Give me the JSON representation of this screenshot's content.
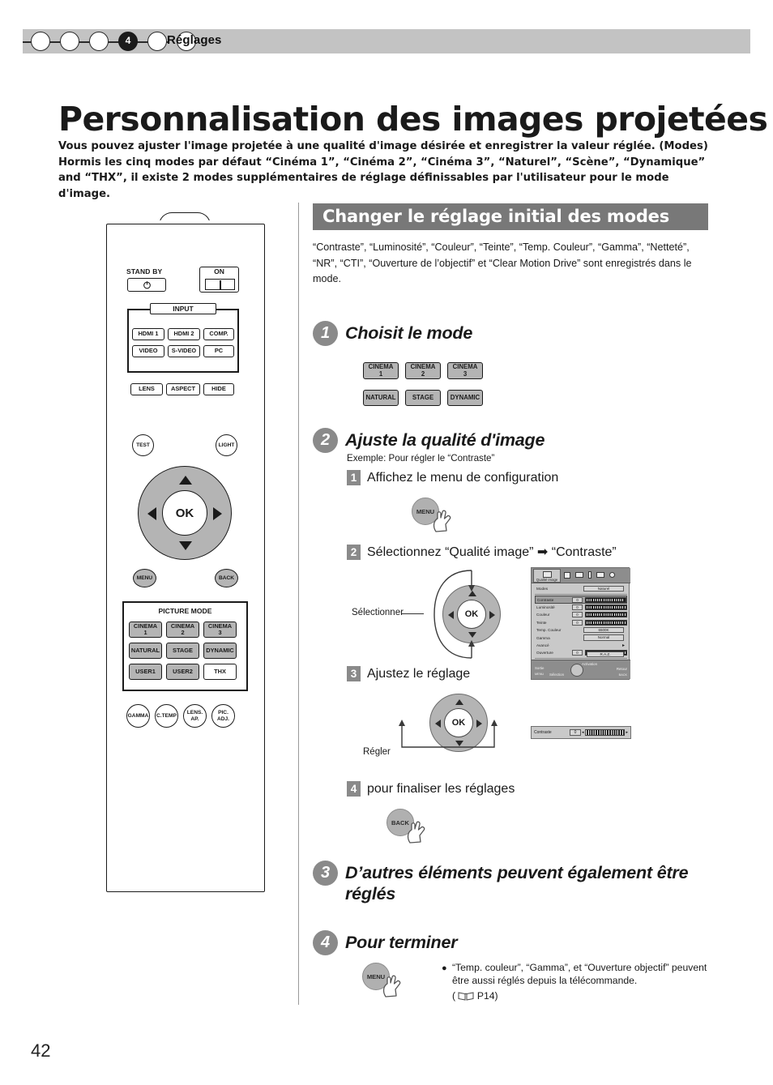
{
  "chapter": {
    "number": "4",
    "title": "Réglages",
    "dots_total": 6,
    "active_index": 3
  },
  "page": {
    "title": "Personnalisation des images projetées",
    "number": "42",
    "intro": "Vous pouvez ajuster l'image projetée à une qualité d'image désirée et enregistrer la valeur réglée. (Modes) Hormis les cinq modes par défaut “Cinéma 1”, “Cinéma 2”, “Cinéma 3”, “Naturel”, “Scène”, “Dynamique” and “THX”, il existe 2 modes supplémentaires de réglage définissables par l'utilisateur pour le mode d'image."
  },
  "section": {
    "heading": "Changer le réglage initial des modes",
    "body": "“Contraste”, “Luminosité”, “Couleur”, “Teinte”, “Temp. Couleur”, “Gamma”, “Netteté”, “NR”, “CTI”, “Ouverture de l’objectif” et “Clear Motion Drive” sont enregistrés dans le mode."
  },
  "remote": {
    "standby_label": "STAND BY",
    "standby_icon": "power-icon",
    "on_label": "ON",
    "on_icon": "power-on-bar-icon",
    "input_group_label": "INPUT",
    "input_buttons": [
      "HDMI 1",
      "HDMI 2",
      "COMP.",
      "VIDEO",
      "S-VIDEO",
      "PC"
    ],
    "function_buttons": [
      "LENS",
      "ASPECT",
      "HIDE"
    ],
    "test_label": "TEST",
    "light_label": "LIGHT",
    "ok_label": "OK",
    "menu_label": "MENU",
    "back_label": "BACK",
    "picture_mode_label": "PICTURE MODE",
    "picture_modes": [
      {
        "line1": "CINEMA",
        "line2": "1",
        "filled": true
      },
      {
        "line1": "CINEMA",
        "line2": "2",
        "filled": true
      },
      {
        "line1": "CINEMA",
        "line2": "3",
        "filled": true
      },
      {
        "line1": "NATURAL",
        "line2": "",
        "filled": true
      },
      {
        "line1": "STAGE",
        "line2": "",
        "filled": true
      },
      {
        "line1": "DYNAMIC",
        "line2": "",
        "filled": true
      },
      {
        "line1": "USER1",
        "line2": "",
        "filled": true
      },
      {
        "line1": "USER2",
        "line2": "",
        "filled": true
      },
      {
        "line1": "THX",
        "line2": "",
        "filled": false
      }
    ],
    "round_buttons": [
      {
        "line1": "GAMMA",
        "line2": ""
      },
      {
        "line1": "C.TEMP",
        "line2": ""
      },
      {
        "line1": "LENS.",
        "line2": "AP."
      },
      {
        "line1": "PIC.",
        "line2": "ADJ."
      }
    ]
  },
  "steps": [
    {
      "num": "1",
      "title": "Choisit le mode"
    },
    {
      "num": "2",
      "title": "Ajuste la qualité d'image"
    },
    {
      "num": "3",
      "title": "D’autres éléments peuvent également être réglés"
    },
    {
      "num": "4",
      "title": "Pour terminer"
    }
  ],
  "step1": {
    "modes": [
      {
        "line1": "CINEMA",
        "line2": "1"
      },
      {
        "line1": "CINEMA",
        "line2": "2"
      },
      {
        "line1": "CINEMA",
        "line2": "3"
      },
      {
        "line1": "NATURAL",
        "line2": ""
      },
      {
        "line1": "STAGE",
        "line2": ""
      },
      {
        "line1": "DYNAMIC",
        "line2": ""
      }
    ]
  },
  "step2": {
    "example": "Exemple: Pour régler le “Contraste”",
    "substeps": [
      {
        "num": "1",
        "text": "Affichez le menu de configuration"
      },
      {
        "num": "2",
        "text": "Sélectionnez “Qualité image” ➡ “Contraste”"
      },
      {
        "num": "3",
        "text": "Ajustez le réglage"
      },
      {
        "num": "4",
        "text": "pour finaliser les réglages"
      }
    ],
    "press_menu": "MENU",
    "press_back": "BACK",
    "callout_select": "Sélectionner",
    "callout_adjust": "Régler",
    "ok_label": "OK"
  },
  "step4": {
    "press_menu": "MENU",
    "note": "“Temp. couleur”, “Gamma”, et “Ouverture objectif” peuvent être aussi réglés depuis la télécommande.",
    "reference": "( P14)",
    "reference_page": "P14"
  },
  "osd": {
    "tab_label": "Qualité image",
    "tab_icons": [
      "picture-quality-icon",
      "sliders-icon",
      "screen-icon",
      "info-icon",
      "network-icon",
      "power-icon"
    ],
    "rows": [
      {
        "name": "Modes",
        "type": "wide",
        "value": "Naturel",
        "selected": false
      },
      {
        "name": "Contraste",
        "type": "slider",
        "value": "0",
        "selected": true
      },
      {
        "name": "Luminosité",
        "type": "slider",
        "value": "0",
        "selected": false
      },
      {
        "name": "Couleur",
        "type": "slider",
        "value": "0",
        "selected": false
      },
      {
        "name": "Teinte",
        "type": "slider",
        "value": "0",
        "selected": false
      },
      {
        "name": "Temp. Couleur",
        "type": "wide",
        "value": "6500K",
        "selected": false
      },
      {
        "name": "Gamma",
        "type": "wide",
        "value": "Normal",
        "selected": false
      },
      {
        "name": "Avancé",
        "type": "arrow",
        "value": "",
        "selected": false
      },
      {
        "name": "Ouverture",
        "type": "slider",
        "value": "0",
        "selected": false
      }
    ],
    "reset_label": "R.A.Z.",
    "footer": {
      "exit_label": "Sortie",
      "exit_key": "MENU",
      "select_label": "Sélection",
      "activate_label": "Activation",
      "return_label": "Retour",
      "return_key": "BACK"
    }
  },
  "contrast_chip": {
    "name": "Contraste",
    "value": "0"
  }
}
